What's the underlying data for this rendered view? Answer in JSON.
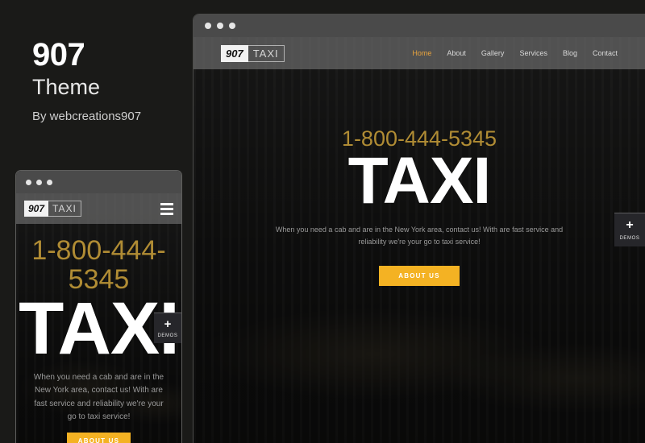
{
  "left_panel": {
    "title": "907",
    "subtitle": "Theme",
    "byline": "By webcreations907"
  },
  "colors": {
    "accent_orange": "#e8a33d",
    "cta_yellow": "#f4b223",
    "phone_gold": "#b08c34",
    "page_background": "#1a1a18",
    "chrome_bar": "#4a4a4a"
  },
  "desktop_mockup": {
    "chrome": {
      "dots": [
        "dot-1",
        "dot-2",
        "dot-3"
      ]
    },
    "logo": {
      "mark": "907",
      "word": "TAXI"
    },
    "nav": [
      {
        "label": "Home",
        "active": true
      },
      {
        "label": "About",
        "active": false
      },
      {
        "label": "Gallery",
        "active": false
      },
      {
        "label": "Services",
        "active": false
      },
      {
        "label": "Blog",
        "active": false
      },
      {
        "label": "Contact",
        "active": false
      }
    ],
    "hero": {
      "phone": "1-800-444-5345",
      "title": "TAXI",
      "description": "When you need a cab and are in the New York area, contact us! With are fast service and reliability we're your go to taxi service!",
      "cta": "ABOUT US"
    },
    "demos_tab": {
      "icon": "plus-icon",
      "label": "DEMOS"
    }
  },
  "mobile_mockup": {
    "chrome": {
      "dots": [
        "dot-1",
        "dot-2",
        "dot-3"
      ]
    },
    "logo": {
      "mark": "907",
      "word": "TAXI"
    },
    "menu_icon": "hamburger-icon",
    "hero": {
      "phone": "1-800-444-5345",
      "title": "TAXI",
      "description": "When you need a cab and are in the New York area, contact us! With are fast service and reliability we're your go to taxi service!",
      "cta": "ABOUT US"
    },
    "demos_tab": {
      "icon": "plus-icon",
      "label": "DEMOS"
    }
  }
}
